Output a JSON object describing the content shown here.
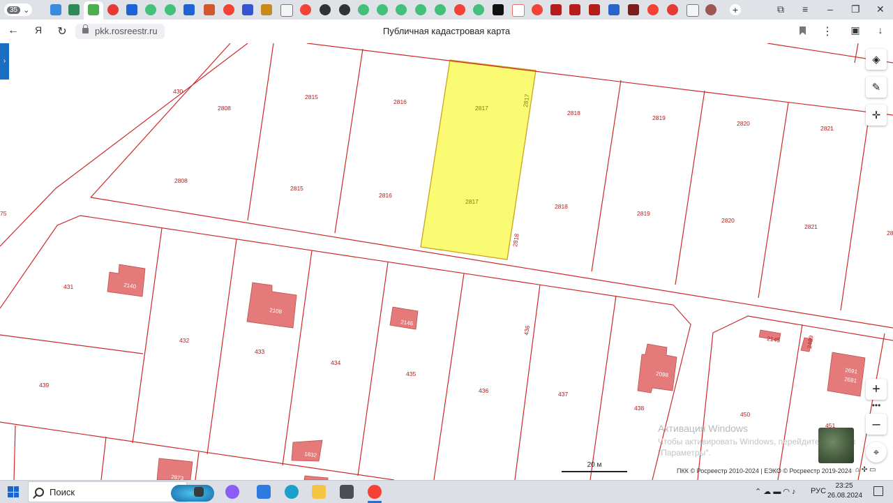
{
  "browser": {
    "tab_counter": "35",
    "url": "pkk.rosreestr.ru",
    "page_title": "Публичная кадастровая карта",
    "accent": "#1b6fc2"
  },
  "map": {
    "highlight_color": "#fbfb73",
    "boundary_color": "#cc2a2a",
    "building_color": "#e47a7a",
    "parcel_labels": [
      "430",
      "2808",
      "2808",
      "2815",
      "2815",
      "2816",
      "2816",
      "2818",
      "2818",
      "2819",
      "2819",
      "2820",
      "2820",
      "2821",
      "2821",
      "75",
      "28",
      "431",
      "432",
      "433",
      "434",
      "435",
      "436",
      "436",
      "437",
      "438",
      "439",
      "450",
      "451"
    ],
    "highlighted_labels": [
      "2817",
      "2817",
      "2817"
    ],
    "side_label": "2818",
    "building_labels": [
      "2140",
      "2108",
      "2146",
      "2098",
      "2145",
      "2489",
      "2691",
      "2691",
      "1832",
      "2873"
    ],
    "scale_label": "20 м",
    "attribution": "ПКК © Росреестр 2010-2024 | ЕЭКО © Росреестр 2019-2024",
    "watermark_title": "Активация Windows",
    "watermark_line1": "Чтобы активировать Windows, перейдите в раздел",
    "watermark_line2": "\"Параметры\"."
  },
  "taskbar": {
    "search_placeholder": "Поиск",
    "language": "РУС",
    "time": "23:25",
    "date": "26.08.2024"
  }
}
